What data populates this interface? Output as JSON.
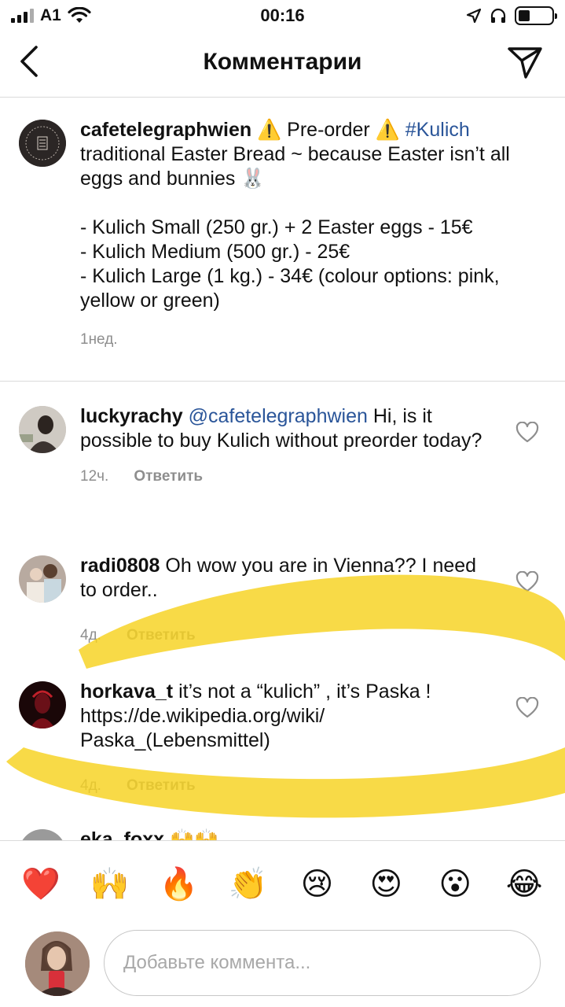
{
  "status_bar": {
    "carrier": "A1",
    "time": "00:16"
  },
  "nav": {
    "title": "Комментарии"
  },
  "caption": {
    "username": "cafetelegraphwien",
    "line_intro": " ⚠️ Pre-order ⚠️ ",
    "hashtag": "#Kulich",
    "text": " traditional Easter Bread ~ because Easter isn’t all eggs and bunnies 🐰\n\n- Kulich Small (250 gr.) + 2 Easter eggs - 15€\n- Kulich Medium (500 gr.) - 25€\n- Kulich Large (1 kg.) - 34€ (colour options: pink, yellow or green)",
    "time": "1нед."
  },
  "comments": [
    {
      "username": "luckyrachy",
      "mention": "@cafetelegraphwien",
      "text": " Hi, is it possible to buy Kulich without preorder today?",
      "time": "12ч.",
      "reply": "Ответить"
    },
    {
      "username": "radi0808",
      "mention": "",
      "text": " Oh wow you are in Vienna?? I need to order..",
      "time": "4д.",
      "reply": "Ответить"
    },
    {
      "username": "horkava_t",
      "mention": "",
      "text": " it’s not a “kulich” , it’s Paska ! https://de.wikipedia.org/wiki/ Paska_(Lebensmittel)",
      "time": "4д.",
      "reply": "Ответить"
    },
    {
      "username": "eka_foxx",
      "mention": "",
      "text": " 🙌🙌",
      "time": "",
      "reply": ""
    }
  ],
  "emoji_bar": [
    "❤️",
    "🙌",
    "🔥",
    "👏",
    "😢",
    "😍",
    "😮",
    "😂"
  ],
  "input": {
    "placeholder": "Добавьте коммента..."
  },
  "colors": {
    "link": "#2a5599",
    "muted": "#8e8e8e",
    "highlighter": "#f6d21f"
  }
}
